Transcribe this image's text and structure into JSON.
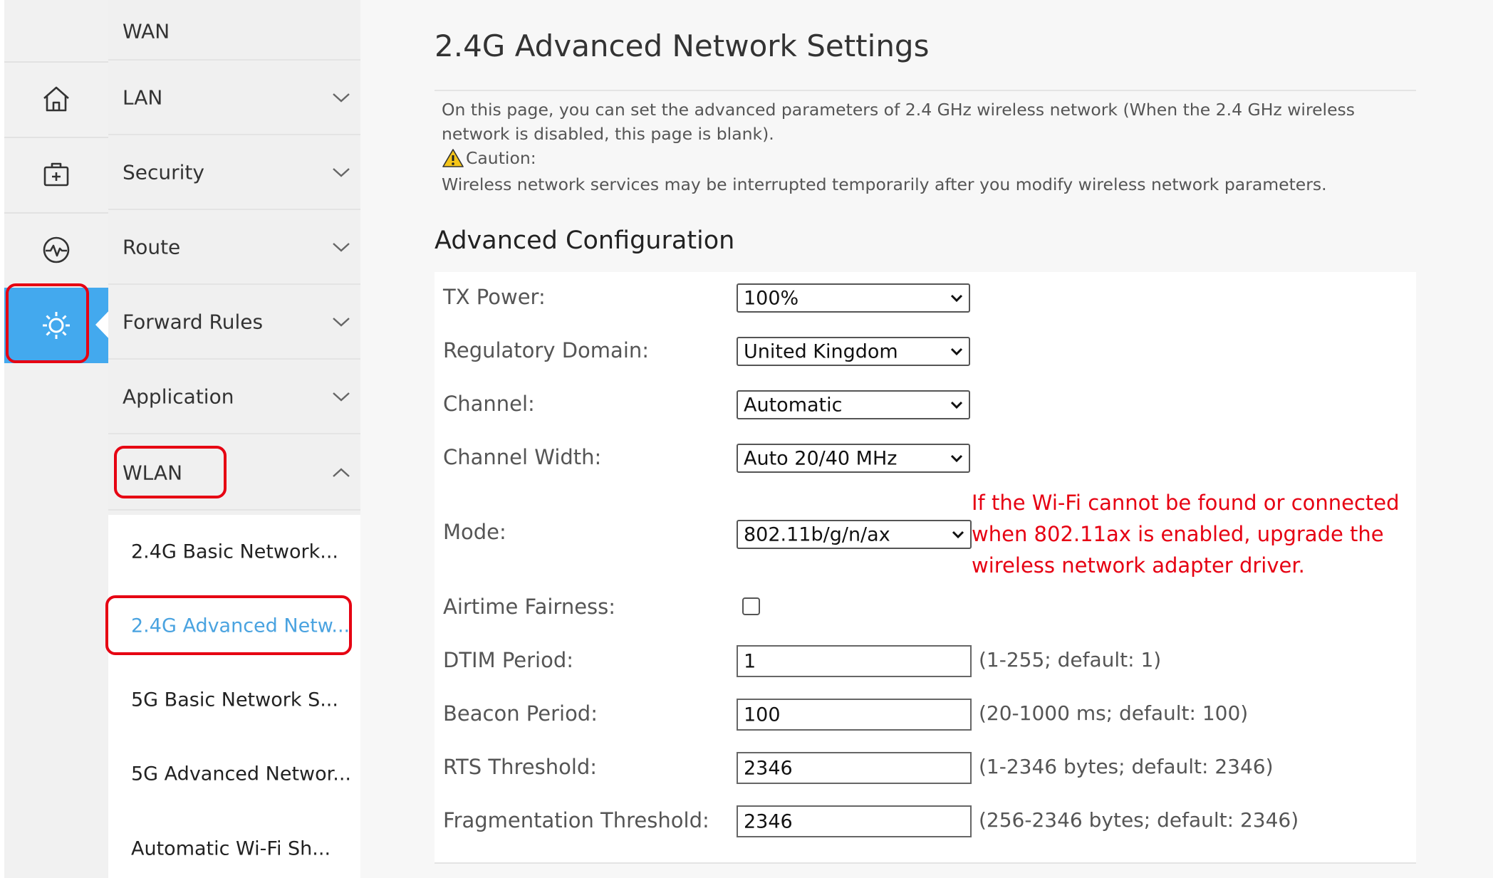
{
  "rail": {
    "items": [
      {
        "icon": "home-icon"
      },
      {
        "icon": "medical-kit-icon"
      },
      {
        "icon": "pulse-icon"
      },
      {
        "icon": "gear-icon",
        "active": true
      }
    ]
  },
  "nav": {
    "items": [
      {
        "label": "WAN"
      },
      {
        "label": "LAN"
      },
      {
        "label": "Security"
      },
      {
        "label": "Route"
      },
      {
        "label": "Forward Rules"
      },
      {
        "label": "Application"
      },
      {
        "label": "WLAN",
        "expanded": true
      }
    ],
    "sub_items": [
      {
        "label": "2.4G Basic Network..."
      },
      {
        "label": "2.4G Advanced Netw...",
        "active": true
      },
      {
        "label": "5G Basic Network S..."
      },
      {
        "label": "5G Advanced Networ..."
      },
      {
        "label": "Automatic Wi-Fi Sh..."
      }
    ]
  },
  "main": {
    "title": "2.4G Advanced Network Settings",
    "description_line1": "On this page, you can set the advanced parameters of 2.4 GHz wireless network (When the 2.4 GHz wireless",
    "description_line2": "network is disabled, this page is blank).",
    "caution_label": "Caution:",
    "caution_text": "Wireless network services may be interrupted temporarily after you modify wireless network parameters.",
    "section_title": "Advanced Configuration",
    "fields": {
      "tx_power": {
        "label": "TX Power:",
        "value": "100%"
      },
      "regulatory_domain": {
        "label": "Regulatory Domain:",
        "value": "United Kingdom"
      },
      "channel": {
        "label": "Channel:",
        "value": "Automatic"
      },
      "channel_width": {
        "label": "Channel Width:",
        "value": "Auto 20/40 MHz"
      },
      "mode": {
        "label": "Mode:",
        "value": "802.11b/g/n/ax",
        "warning_line1": "If the Wi-Fi cannot be found or connected",
        "warning_line2": "when 802.11ax is enabled, upgrade the",
        "warning_line3": "wireless network adapter driver."
      },
      "airtime_fairness": {
        "label": "Airtime Fairness:",
        "checked": false
      },
      "dtim_period": {
        "label": "DTIM Period:",
        "value": "1",
        "hint": "(1-255; default: 1)"
      },
      "beacon_period": {
        "label": "Beacon Period:",
        "value": "100",
        "hint": "(20-1000 ms; default: 100)"
      },
      "rts_threshold": {
        "label": "RTS Threshold:",
        "value": "2346",
        "hint": "(1-2346 bytes; default: 2346)"
      },
      "fragmentation_threshold": {
        "label": "Fragmentation Threshold:",
        "value": "2346",
        "hint": "(256-2346 bytes; default: 2346)"
      }
    }
  },
  "colors": {
    "accent": "#43a9ee",
    "highlight_outline": "#e60012",
    "warning_text": "#e60012",
    "active_sub_text": "#4aa3e0"
  }
}
